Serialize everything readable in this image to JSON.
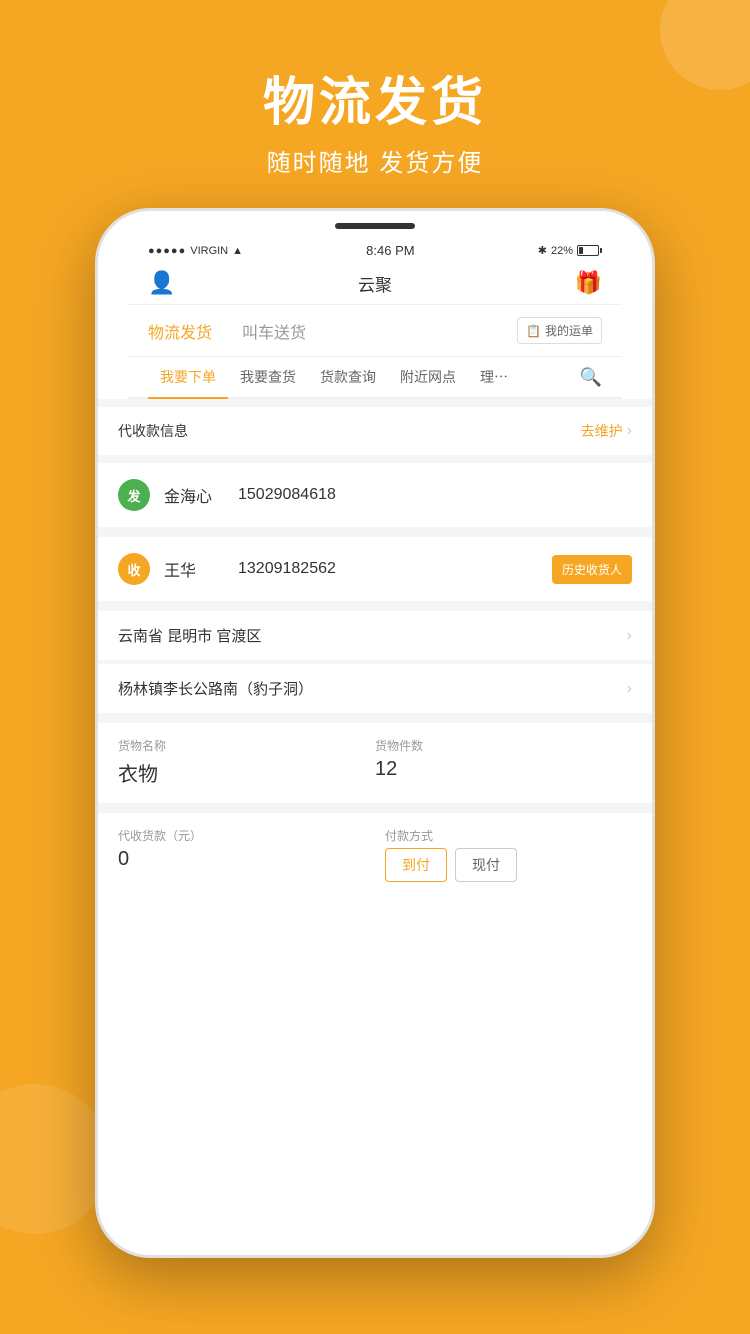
{
  "background_color": "#F5A623",
  "header": {
    "title": "物流发货",
    "subtitle": "随时随地 发货方便"
  },
  "status_bar": {
    "carrier": "VIRGIN",
    "time": "8:46 PM",
    "bluetooth": "✱",
    "battery_percent": "22%"
  },
  "nav": {
    "title": "云聚",
    "gift_icon": "🎁"
  },
  "tabs": [
    {
      "label": "物流发货",
      "active": true
    },
    {
      "label": "叫车送货",
      "active": false
    }
  ],
  "my_waybill": "我的运单",
  "sub_tabs": [
    {
      "label": "我要下单",
      "active": true
    },
    {
      "label": "我要查货",
      "active": false
    },
    {
      "label": "货款查询",
      "active": false
    },
    {
      "label": "附近网点",
      "active": false
    },
    {
      "label": "理⋯",
      "active": false
    }
  ],
  "cod_section": {
    "label": "代收款信息",
    "action": "去维护"
  },
  "sender": {
    "badge": "发",
    "name": "金海心",
    "phone": "15029084618"
  },
  "receiver": {
    "badge": "收",
    "name": "王华",
    "phone": "13209182562",
    "history_btn": "历史收货人"
  },
  "address1": "云南省 昆明市 官渡区",
  "address2": "杨林镇李长公路南（豹子洞）",
  "goods": {
    "name_label": "货物名称",
    "name_value": "衣物",
    "count_label": "货物件数",
    "count_value": "12"
  },
  "payment": {
    "cod_label": "代收货款（元）",
    "cod_value": "0",
    "method_label": "付款方式",
    "option1": "到付",
    "option2": "现付"
  }
}
